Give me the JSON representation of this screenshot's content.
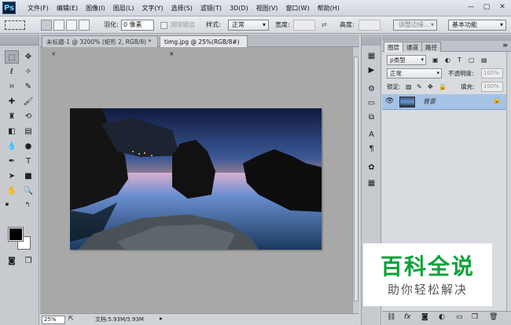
{
  "app": {
    "logo": "Ps"
  },
  "menu": [
    "文件(F)",
    "编辑(E)",
    "图像(I)",
    "图层(L)",
    "文字(Y)",
    "选择(S)",
    "滤镜(T)",
    "3D(D)",
    "视图(V)",
    "窗口(W)",
    "帮助(H)"
  ],
  "window_controls": {
    "minimize": "—",
    "maximize": "▢",
    "close": "✕"
  },
  "options": {
    "feather_label": "羽化:",
    "feather_value": "0 像素",
    "antialias_label": "消除锯齿",
    "style_label": "样式:",
    "style_value": "正常",
    "width_label": "宽度:",
    "height_label": "高度:",
    "refine_edge": "调整边缘...",
    "workspace": "基本功能"
  },
  "doc_tabs": [
    {
      "label": "未标题-1 @ 3200% (矩形 2, RGB/8) *",
      "close": "×"
    },
    {
      "label": "timg.jpg @ 25%(RGB/8#)",
      "close": "×"
    }
  ],
  "status": {
    "zoom": "25%",
    "doc": "文档:5.93M/5.93M"
  },
  "panel": {
    "tabs": [
      "图层",
      "通道",
      "路径"
    ],
    "kind_label": "ρ类型",
    "blend_mode": "正常",
    "opacity_label": "不透明度:",
    "opacity_value": "100%",
    "lock_label": "锁定:",
    "fill_label": "填充:",
    "fill_value": "100%",
    "layer_name": "背景"
  },
  "watermark": {
    "title": "百科全说",
    "subtitle": "助你轻松解决"
  }
}
